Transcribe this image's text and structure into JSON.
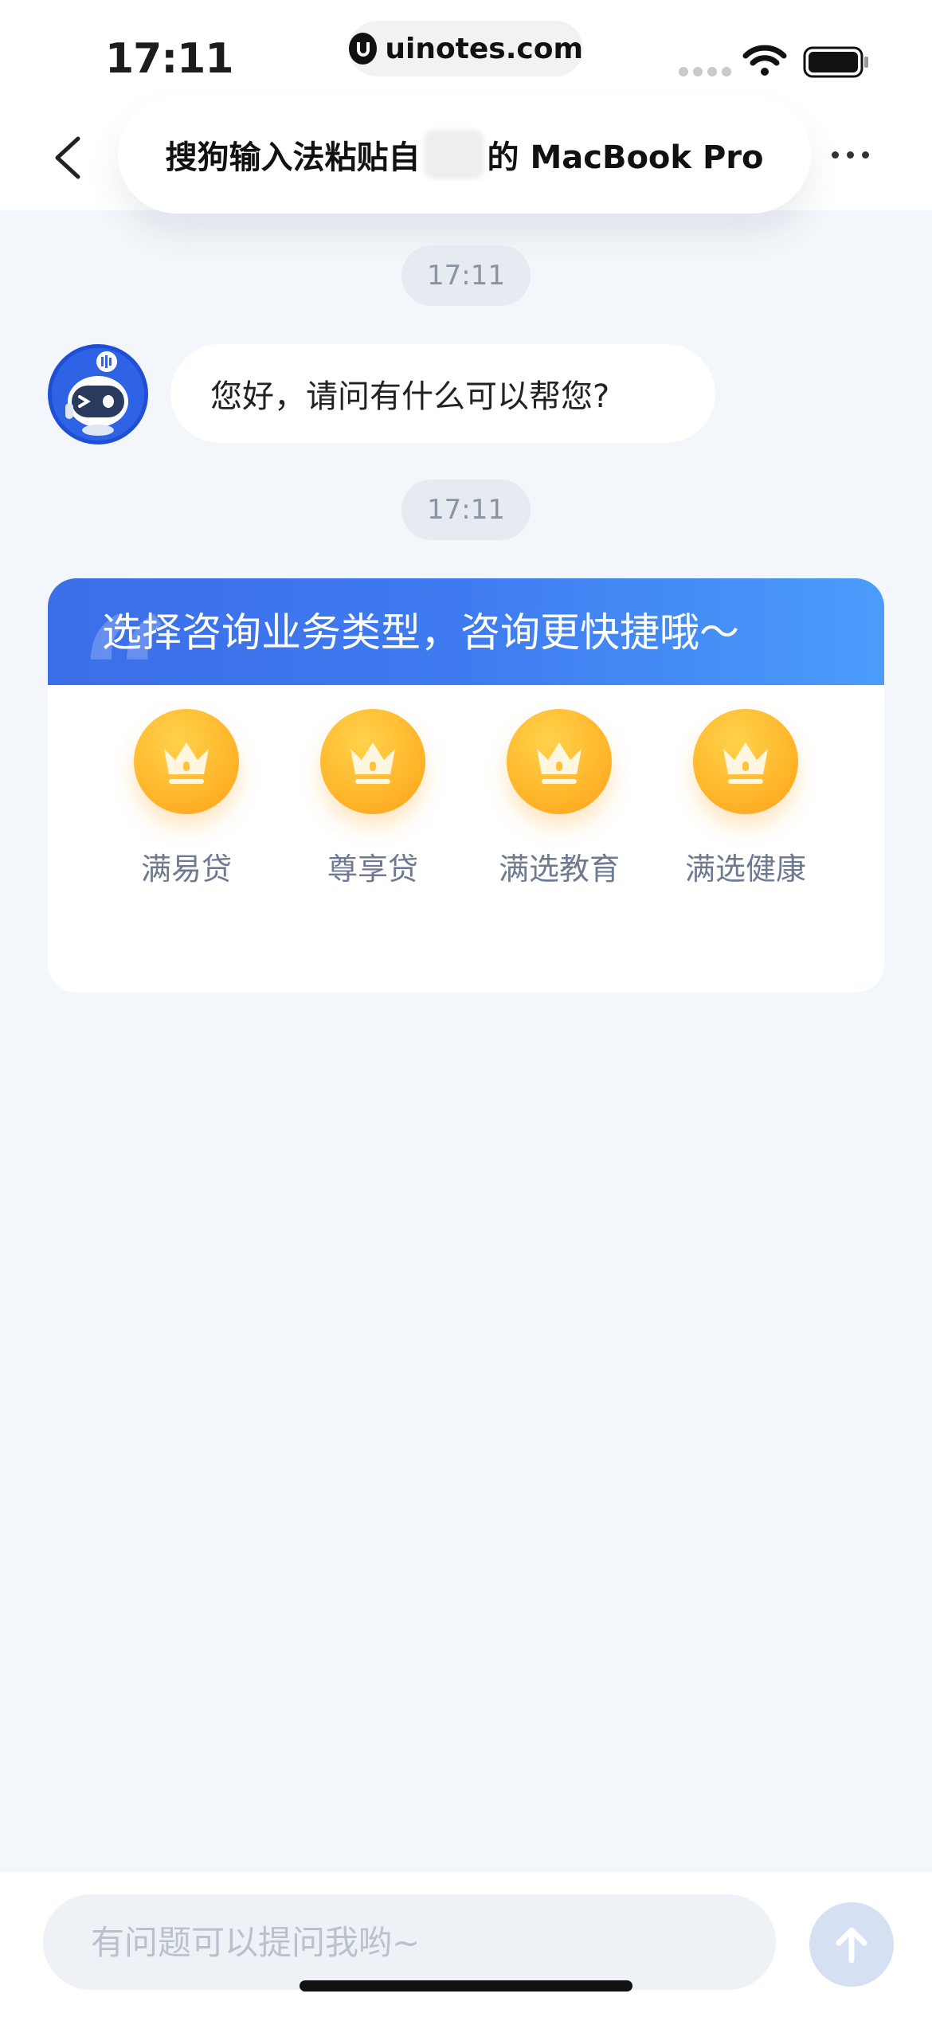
{
  "status_bar": {
    "time": "17:11",
    "url": "uinotes.com"
  },
  "nav": {
    "title_prefix": "搜狗输入法粘贴自",
    "title_suffix": "的 MacBook Pro"
  },
  "chat": {
    "timestamps": [
      "17:11",
      "17:11"
    ],
    "bot_message": "您好，请问有什么可以帮您?"
  },
  "card": {
    "title": "选择咨询业务类型，咨询更快捷哦～",
    "categories": [
      {
        "label": "满易贷",
        "icon": "crown-icon"
      },
      {
        "label": "尊享贷",
        "icon": "crown-icon"
      },
      {
        "label": "满选教育",
        "icon": "crown-icon"
      },
      {
        "label": "满选健康",
        "icon": "crown-icon"
      }
    ]
  },
  "composer": {
    "placeholder": "有问题可以提问我哟~",
    "send_icon": "arrow-up-icon"
  },
  "colors": {
    "accent_blue": "#3b6ee8",
    "background": "#f3f6fa",
    "crown_orange": "#ffb62b"
  }
}
